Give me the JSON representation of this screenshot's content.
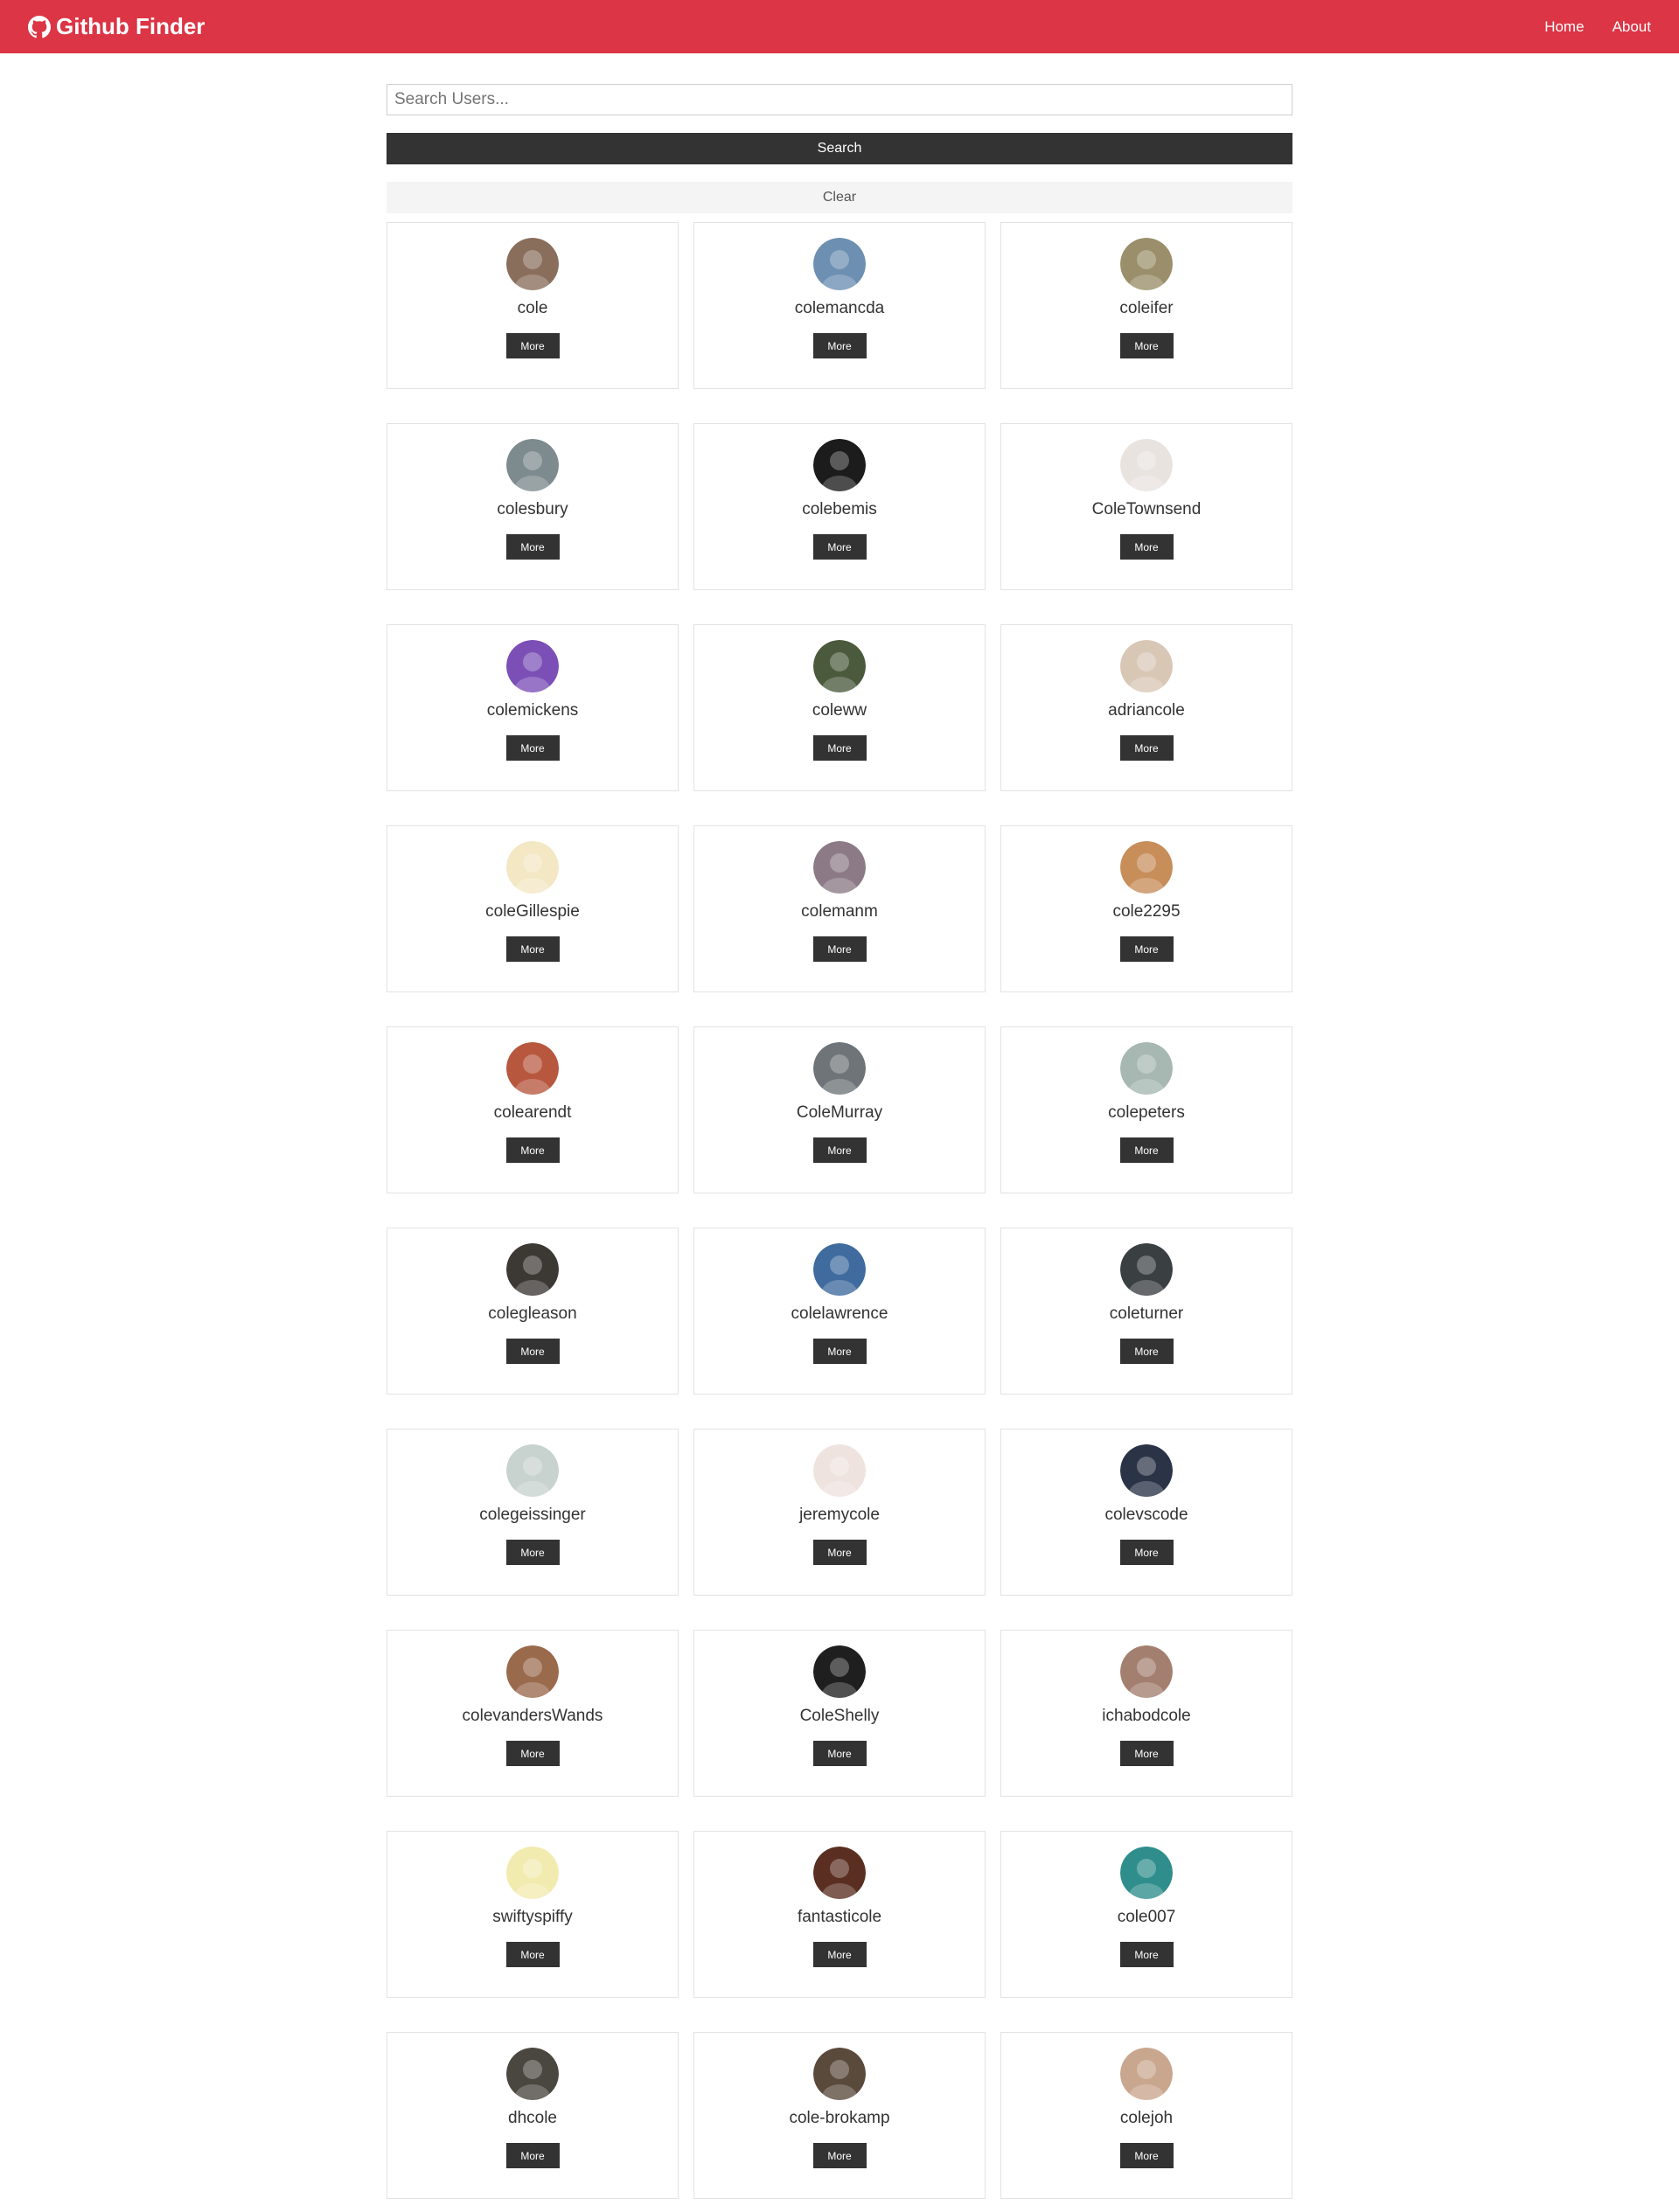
{
  "navbar": {
    "brand": "Github Finder",
    "brand_icon": "github-icon",
    "links": [
      "Home",
      "About"
    ],
    "color": "#dc3545"
  },
  "search": {
    "placeholder": "Search Users...",
    "value": "",
    "search_label": "Search",
    "clear_label": "Clear"
  },
  "users": [
    {
      "login": "cole",
      "avatar_color": "#8a6e5c"
    },
    {
      "login": "colemancda",
      "avatar_color": "#6c8fb2"
    },
    {
      "login": "coleifer",
      "avatar_color": "#9a8f6a"
    },
    {
      "login": "colesbury",
      "avatar_color": "#7d8a8e"
    },
    {
      "login": "colebemis",
      "avatar_color": "#1c1c1c"
    },
    {
      "login": "ColeTownsend",
      "avatar_color": "#e9e3e0"
    },
    {
      "login": "colemickens",
      "avatar_color": "#7b4fb6"
    },
    {
      "login": "coleww",
      "avatar_color": "#4b5a3d"
    },
    {
      "login": "adriancole",
      "avatar_color": "#d9c7b6"
    },
    {
      "login": "coleGillespie",
      "avatar_color": "#f3e7c4"
    },
    {
      "login": "colemanm",
      "avatar_color": "#8c7a86"
    },
    {
      "login": "cole2295",
      "avatar_color": "#c78e5a"
    },
    {
      "login": "colearendt",
      "avatar_color": "#b7583e"
    },
    {
      "login": "ColeMurray",
      "avatar_color": "#6e7478"
    },
    {
      "login": "colepeters",
      "avatar_color": "#a6b8b1"
    },
    {
      "login": "colegleason",
      "avatar_color": "#3c3834"
    },
    {
      "login": "colelawrence",
      "avatar_color": "#3f6b9e"
    },
    {
      "login": "coleturner",
      "avatar_color": "#3a3f42"
    },
    {
      "login": "colegeissinger",
      "avatar_color": "#c8d2cf"
    },
    {
      "login": "jeremycole",
      "avatar_color": "#efe3df"
    },
    {
      "login": "colevscode",
      "avatar_color": "#2b3447"
    },
    {
      "login": "colevandersWands",
      "avatar_color": "#9a6a4d"
    },
    {
      "login": "ColeShelly",
      "avatar_color": "#1f1f1f"
    },
    {
      "login": "ichabodcole",
      "avatar_color": "#a37f70"
    },
    {
      "login": "swiftyspiffy",
      "avatar_color": "#f2ebb0"
    },
    {
      "login": "fantasticole",
      "avatar_color": "#5a2f22"
    },
    {
      "login": "cole007",
      "avatar_color": "#2f8e8c"
    },
    {
      "login": "dhcole",
      "avatar_color": "#4a4640"
    },
    {
      "login": "cole-brokamp",
      "avatar_color": "#5a4a3c"
    },
    {
      "login": "colejoh",
      "avatar_color": "#c9a68e"
    }
  ],
  "card": {
    "button_label": "More",
    "avatar_icon": "user-avatar"
  }
}
